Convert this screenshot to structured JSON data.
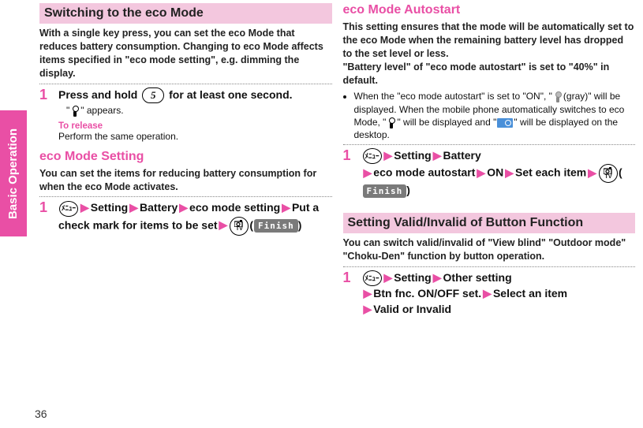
{
  "side_tab": "Basic Operation",
  "page_number": "36",
  "left": {
    "sec1": {
      "bar": "Switching to the eco Mode",
      "intro": "With a single key press, you can set the eco Mode that reduces battery consumption. Changing to eco Mode affects items specified in \"eco mode setting\", e.g. dimming the display.",
      "step1": {
        "num": "1",
        "line_a": "Press and hold ",
        "key_label": "5",
        "line_b": " for at least one second.",
        "appears_a": "\"",
        "appears_b": "\" appears.",
        "to_release": "To release",
        "release_body": "Perform the same operation."
      }
    },
    "sec2": {
      "title": "eco Mode Setting",
      "intro": "You can set the items for reducing battery consumption for when the eco Mode activates.",
      "step1": {
        "num": "1",
        "menu_label": "ﾒﾆｭｰ",
        "p1": "Setting",
        "p2": "Battery",
        "p3": "eco mode setting",
        "p4": "Put a check mark for items to be set",
        "finish": "Finish"
      }
    }
  },
  "right": {
    "sec3": {
      "title": "eco Mode Autostart",
      "intro": "This setting ensures that the mode will be automatically set to the eco Mode when the remaining battery level has dropped to the set level or less.\n\"Battery level\" of \"eco mode autostart\" is set to \"40%\" in default.",
      "bullet_a": "When the \"eco mode autostart\" is set to \"ON\", \"",
      "bullet_b": "(gray)\" will be displayed. When the mobile phone automatically switches to eco Mode, \"",
      "bullet_c": "\" will be displayed and \"",
      "bullet_d": "\" will be displayed on the desktop.",
      "step1": {
        "num": "1",
        "menu_label": "ﾒﾆｭｰ",
        "p1": "Setting",
        "p2": "Battery",
        "p3": "eco mode autostart",
        "p4": "ON",
        "p5": "Set each item",
        "finish": "Finish"
      }
    },
    "sec4": {
      "bar": "Setting Valid/Invalid of Button Function",
      "intro": "You can switch valid/invalid of \"View blind\" \"Outdoor mode\" \"Choku-Den\" function by button operation.",
      "step1": {
        "num": "1",
        "menu_label": "ﾒﾆｭｰ",
        "p1": "Setting",
        "p2": "Other setting",
        "p3": "Btn fnc. ON/OFF set.",
        "p4": "Select an item",
        "p5": "Valid or Invalid"
      }
    }
  }
}
